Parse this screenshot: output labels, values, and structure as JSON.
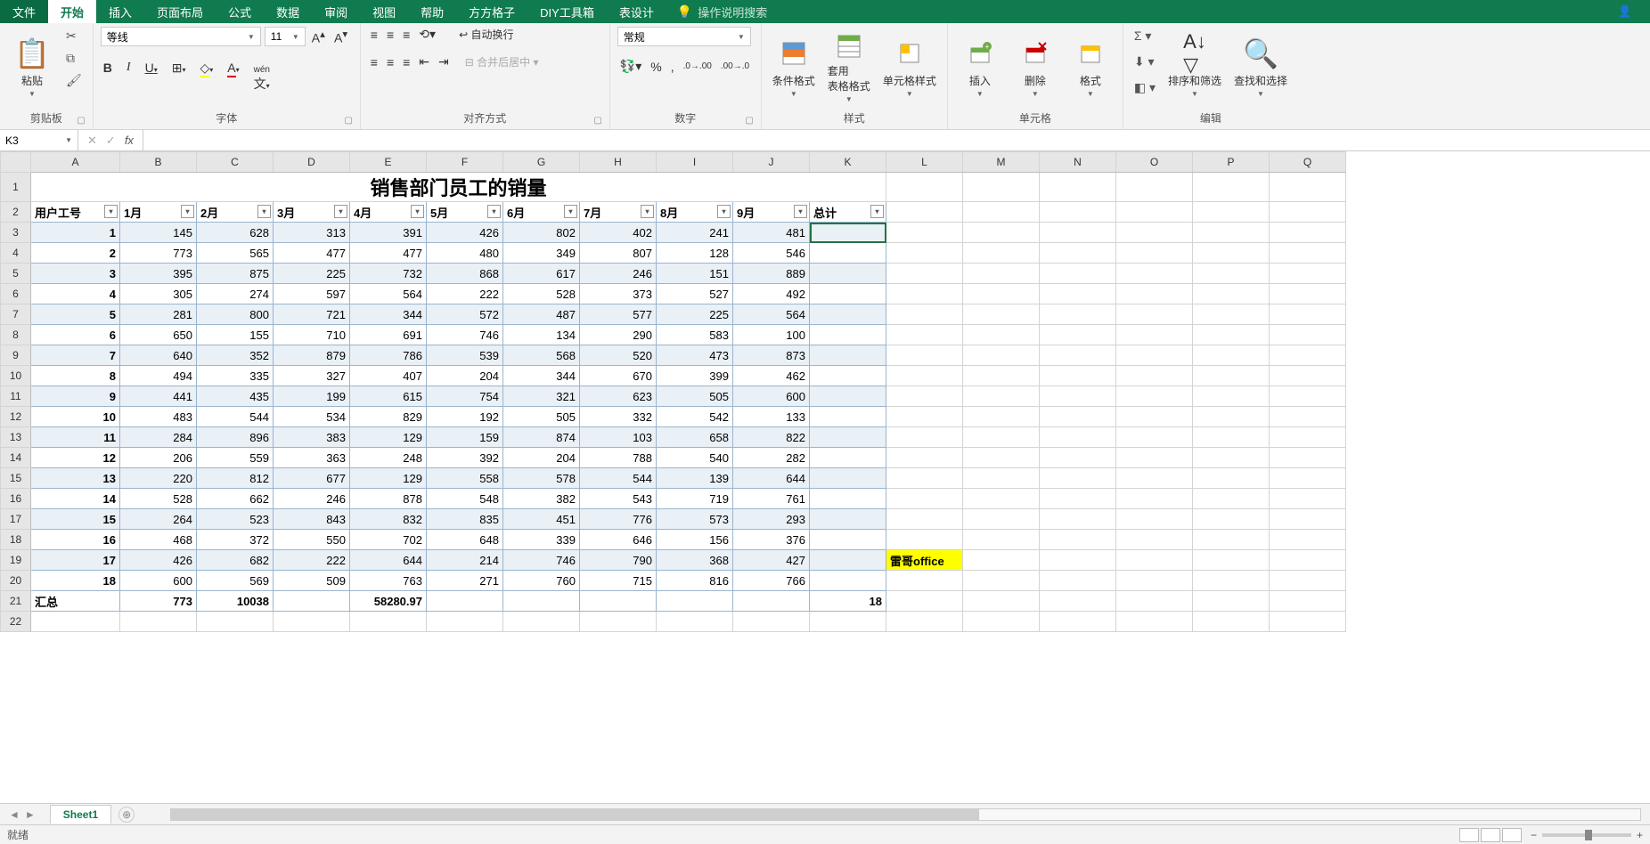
{
  "tabs": {
    "file": "文件",
    "home": "开始",
    "insert": "插入",
    "layout": "页面布局",
    "formula": "公式",
    "data": "数据",
    "review": "审阅",
    "view": "视图",
    "help": "帮助",
    "fangfang": "方方格子",
    "diy": "DIY工具箱",
    "table": "表设计",
    "search": "操作说明搜索"
  },
  "ribbon": {
    "clipboard": {
      "label": "剪贴板",
      "paste": "粘贴"
    },
    "font": {
      "label": "字体",
      "name": "等线",
      "size": "11"
    },
    "align": {
      "label": "对齐方式",
      "wrap": "自动换行",
      "merge": "合并后居中"
    },
    "number": {
      "label": "数字",
      "format": "常规"
    },
    "styles": {
      "label": "样式",
      "cond": "条件格式",
      "table": "套用\n表格格式",
      "cell": "单元格样式"
    },
    "cells": {
      "label": "单元格",
      "insert": "插入",
      "delete": "删除",
      "format": "格式"
    },
    "editing": {
      "label": "编辑",
      "sort": "排序和筛选",
      "find": "查找和选择"
    }
  },
  "namebox": "K3",
  "sheet": {
    "title": "销售部门员工的销量",
    "headers": [
      "用户工号",
      "1月",
      "2月",
      "3月",
      "4月",
      "5月",
      "6月",
      "7月",
      "8月",
      "9月",
      "总计"
    ],
    "rows": [
      [
        "1",
        145,
        628,
        313,
        391,
        426,
        802,
        402,
        241,
        481,
        ""
      ],
      [
        "2",
        773,
        565,
        477,
        477,
        480,
        349,
        807,
        128,
        546,
        ""
      ],
      [
        "3",
        395,
        875,
        225,
        732,
        868,
        617,
        246,
        151,
        889,
        ""
      ],
      [
        "4",
        305,
        274,
        597,
        564,
        222,
        528,
        373,
        527,
        492,
        ""
      ],
      [
        "5",
        281,
        800,
        721,
        344,
        572,
        487,
        577,
        225,
        564,
        ""
      ],
      [
        "6",
        650,
        155,
        710,
        691,
        746,
        134,
        290,
        583,
        100,
        ""
      ],
      [
        "7",
        640,
        352,
        879,
        786,
        539,
        568,
        520,
        473,
        873,
        ""
      ],
      [
        "8",
        494,
        335,
        327,
        407,
        204,
        344,
        670,
        399,
        462,
        ""
      ],
      [
        "9",
        441,
        435,
        199,
        615,
        754,
        321,
        623,
        505,
        600,
        ""
      ],
      [
        "10",
        483,
        544,
        534,
        829,
        192,
        505,
        332,
        542,
        133,
        ""
      ],
      [
        "11",
        284,
        896,
        383,
        129,
        159,
        874,
        103,
        658,
        822,
        ""
      ],
      [
        "12",
        206,
        559,
        363,
        248,
        392,
        204,
        788,
        540,
        282,
        ""
      ],
      [
        "13",
        220,
        812,
        677,
        129,
        558,
        578,
        544,
        139,
        644,
        ""
      ],
      [
        "14",
        528,
        662,
        246,
        878,
        548,
        382,
        543,
        719,
        761,
        ""
      ],
      [
        "15",
        264,
        523,
        843,
        832,
        835,
        451,
        776,
        573,
        293,
        ""
      ],
      [
        "16",
        468,
        372,
        550,
        702,
        648,
        339,
        646,
        156,
        376,
        ""
      ],
      [
        "17",
        426,
        682,
        222,
        644,
        214,
        746,
        790,
        368,
        427,
        ""
      ],
      [
        "18",
        600,
        569,
        509,
        763,
        271,
        760,
        715,
        816,
        766,
        ""
      ]
    ],
    "summary_label": "汇总",
    "summary": [
      "",
      773,
      10038,
      "",
      58280.97,
      "",
      "",
      "",
      "",
      "",
      18
    ],
    "note": "雷哥office",
    "sheet_name": "Sheet1"
  },
  "columns": [
    "A",
    "B",
    "C",
    "D",
    "E",
    "F",
    "G",
    "H",
    "I",
    "J",
    "K",
    "L",
    "M",
    "N",
    "O",
    "P",
    "Q"
  ],
  "status": {
    "ready": "就绪",
    "zoom": ""
  }
}
